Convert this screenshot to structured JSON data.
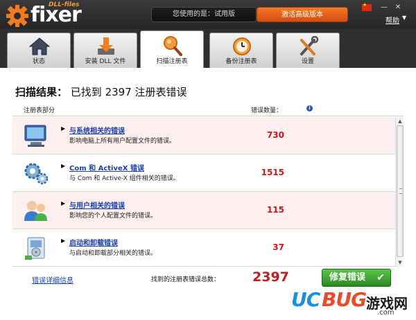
{
  "window": {
    "logo_prefix": "DLL-files",
    "logo_text": "fixer",
    "status_text": "您使用的是：试用版",
    "activate_label": "激活高级版本",
    "help_label": "帮助",
    "minimize_symbol": "—",
    "close_symbol": "✕"
  },
  "tabs": [
    {
      "label": "状态",
      "icon": "home-icon",
      "active": false
    },
    {
      "label": "安装 DLL 文件",
      "icon": "download-icon",
      "active": false
    },
    {
      "label": "扫描注册表",
      "icon": "magnifier-icon",
      "active": true
    },
    {
      "label": "备份注册表",
      "icon": "clock-backup-icon",
      "active": false
    },
    {
      "label": "设置",
      "icon": "tools-icon",
      "active": false
    }
  ],
  "scan": {
    "title_prefix": "扫描结果：",
    "title_text": "已找到 2397 注册表错误",
    "col_section": "注册表部分",
    "col_count": "错误数量：",
    "info_symbol": "i"
  },
  "rows": [
    {
      "title": "与系统相关的错误",
      "desc": "影响电脑上所有用户配置文件的错误。",
      "count": "730",
      "icon": "monitor-icon"
    },
    {
      "title": "Com 和 ActiveX 错误",
      "desc": "与 Com 和 Active-X 组件相关的错误。",
      "count": "1515",
      "icon": "gears-icon"
    },
    {
      "title": "与用户相关的错误",
      "desc": "影响您的个人配置文件的错误。",
      "count": "115",
      "icon": "users-icon"
    },
    {
      "title": "启动和卸载错误",
      "desc": "与启动和卸载部分相关的错误。",
      "count": "37",
      "icon": "installer-icon"
    }
  ],
  "footer": {
    "details_link": "错误详细信息",
    "total_label": "找到的注册表错误总数：",
    "total_value": "2397",
    "fix_label": "修复错误",
    "fix_check": "✔"
  },
  "watermark": {
    "uc": "UC",
    "bug": "BUG",
    "cn": "游戏网",
    "com": ".com"
  },
  "colors": {
    "accent_orange": "#e05a1a",
    "error_red": "#c41a1a",
    "link_blue": "#1a3fa6",
    "fix_green": "#3aa52e"
  }
}
